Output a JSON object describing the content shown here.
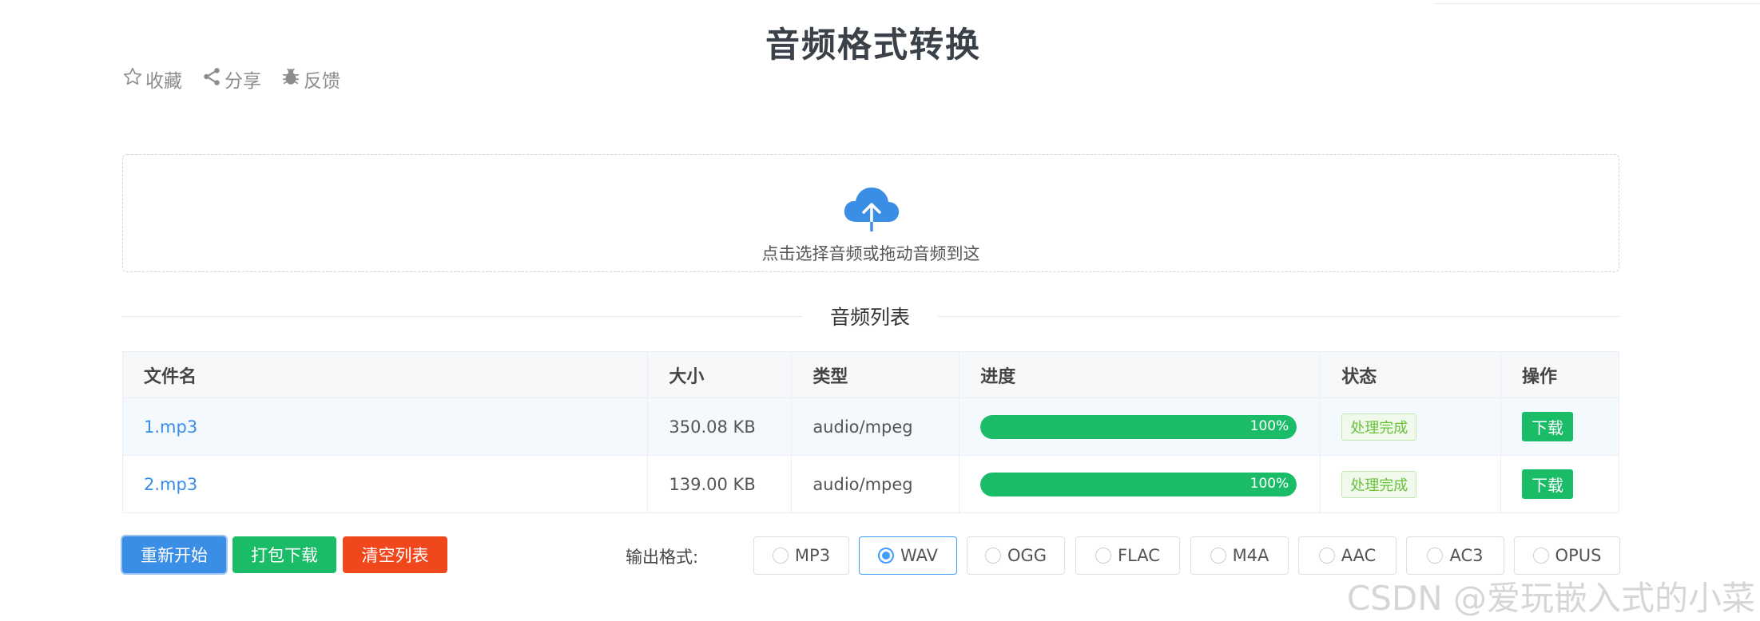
{
  "page": {
    "title": "音频格式转换"
  },
  "actions": [
    {
      "label": "收藏",
      "icon": "star-icon"
    },
    {
      "label": "分享",
      "icon": "share-icon"
    },
    {
      "label": "反馈",
      "icon": "bug-icon"
    }
  ],
  "upload": {
    "text": "点击选择音频或拖动音频到这",
    "icon": "cloud-upload-icon"
  },
  "list": {
    "title": "音频列表"
  },
  "table": {
    "headers": [
      "文件名",
      "大小",
      "类型",
      "进度",
      "状态",
      "操作"
    ],
    "rows": [
      {
        "name": "1.mp3",
        "size": "350.08 KB",
        "type": "audio/mpeg",
        "progress": 100,
        "progress_label": "100%",
        "status": "处理完成",
        "action": "下载"
      },
      {
        "name": "2.mp3",
        "size": "139.00 KB",
        "type": "audio/mpeg",
        "progress": 100,
        "progress_label": "100%",
        "status": "处理完成",
        "action": "下载"
      }
    ]
  },
  "buttons": {
    "restart": "重新开始",
    "pack": "打包下载",
    "clear": "清空列表"
  },
  "format": {
    "label": "输出格式:",
    "options": [
      "MP3",
      "WAV",
      "OGG",
      "FLAC",
      "M4A",
      "AAC",
      "AC3",
      "OPUS"
    ],
    "selected": "WAV"
  },
  "watermark": "CSDN @爱玩嵌入式的小菜",
  "colors": {
    "primary": "#3a8ee6",
    "success": "#1abc68",
    "danger": "#f0481c"
  }
}
